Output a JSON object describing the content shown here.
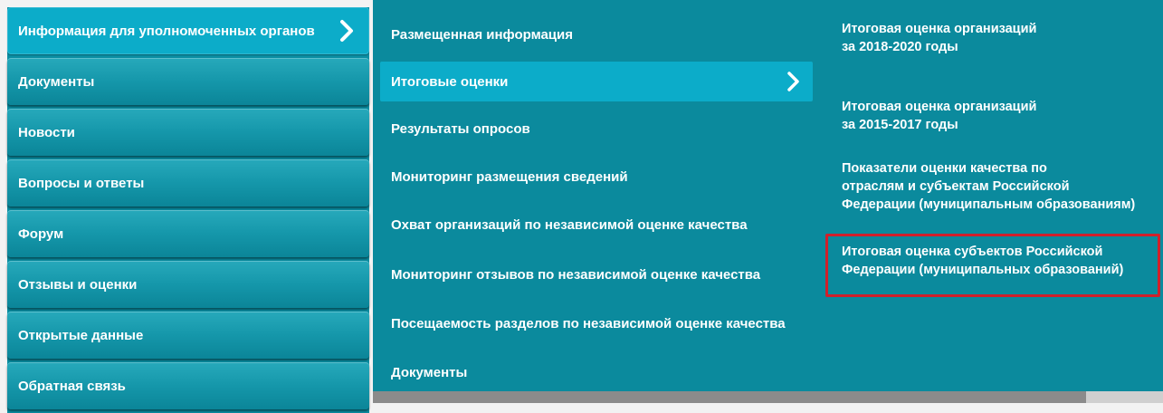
{
  "left_menu": {
    "items": [
      {
        "label": "Информация для уполномоченных органов",
        "active": true
      },
      {
        "label": "Документы"
      },
      {
        "label": "Новости"
      },
      {
        "label": "Вопросы и ответы"
      },
      {
        "label": "Форум"
      },
      {
        "label": "Отзывы и оценки"
      },
      {
        "label": "Открытые данные"
      },
      {
        "label": "Обратная связь"
      }
    ]
  },
  "middle_menu": {
    "items": [
      {
        "label": "Размещенная информация"
      },
      {
        "label": "Итоговые оценки",
        "active": true
      },
      {
        "label": "Результаты опросов"
      },
      {
        "label": "Мониторинг размещения сведений"
      },
      {
        "label": "Охват организаций по независимой оценке качества"
      },
      {
        "label": "Мониторинг отзывов по независимой оценке качества"
      },
      {
        "label": "Посещаемость разделов по независимой оценке качества"
      },
      {
        "label": "Документы"
      }
    ]
  },
  "right_menu": {
    "items": [
      {
        "label": "Итоговая оценка организаций\nза 2018-2020 годы"
      },
      {
        "label": "Итоговая оценка организаций\nза 2015-2017 годы"
      },
      {
        "label": "Показатели оценки качества по\nотраслям и субъектам Российской\nФедерации (муниципальным образованиям)"
      },
      {
        "label": "Итоговая оценка субъектов Российской\nФедерации (муниципальных образований)",
        "highlighted": true
      }
    ]
  },
  "colors": {
    "panel": "#0b8a9d",
    "active": "#0cacc9",
    "highlight_border": "#d0202b"
  },
  "icons": [
    "chevron-right-icon"
  ]
}
